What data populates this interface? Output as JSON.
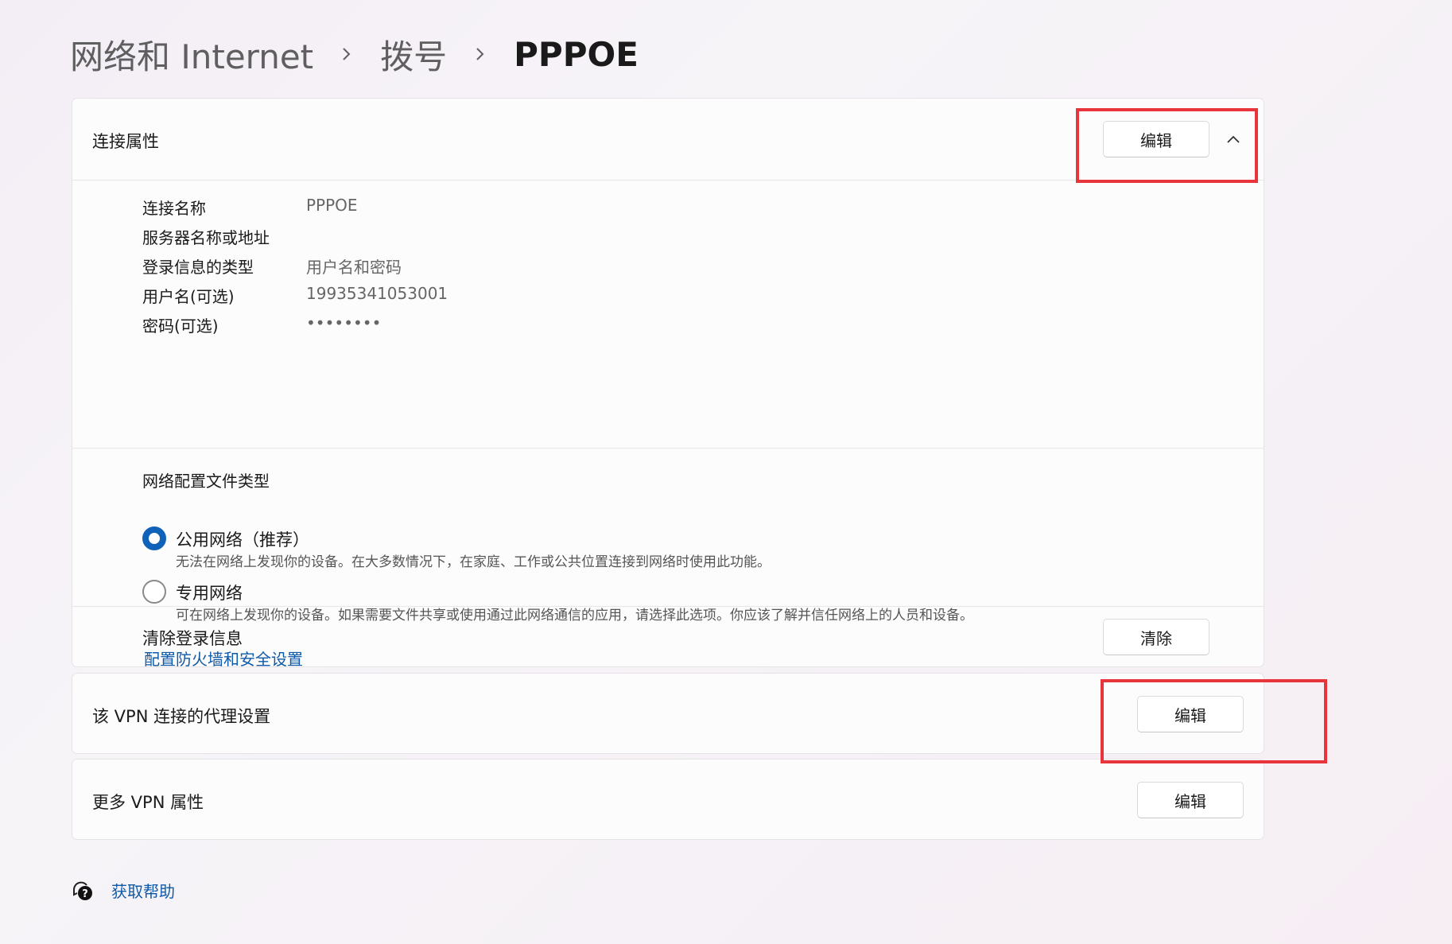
{
  "breadcrumb": {
    "items": [
      "网络和 Internet",
      "拨号"
    ],
    "current": "PPPOE"
  },
  "connection_properties": {
    "title": "连接属性",
    "edit_label": "编辑",
    "expanded": true,
    "fields": [
      {
        "label": "连接名称",
        "value": "PPPOE"
      },
      {
        "label": "服务器名称或地址",
        "value": ""
      },
      {
        "label": "登录信息的类型",
        "value": "用户名和密码"
      },
      {
        "label": "用户名(可选)",
        "value": "19935341053001"
      },
      {
        "label": "密码(可选)",
        "value": "••••••••"
      }
    ]
  },
  "network_profile": {
    "title": "网络配置文件类型",
    "options": [
      {
        "label": "公用网络（推荐）",
        "description": "无法在网络上发现你的设备。在大多数情况下，在家庭、工作或公共位置连接到网络时使用此功能。",
        "selected": true
      },
      {
        "label": "专用网络",
        "description": "可在网络上发现你的设备。如果需要文件共享或使用通过此网络通信的应用，请选择此选项。你应该了解并信任网络上的人员和设备。",
        "selected": false
      }
    ],
    "firewall_link": "配置防火墙和安全设置"
  },
  "clear_login": {
    "label": "清除登录信息",
    "button_label": "清除"
  },
  "proxy": {
    "label": "该 VPN 连接的代理设置",
    "button_label": "编辑"
  },
  "more_vpn": {
    "label": "更多 VPN 属性",
    "button_label": "编辑"
  },
  "help": {
    "label": "获取帮助",
    "icon": "help-chat-icon"
  },
  "colors": {
    "accent": "#0f62b8",
    "highlight": "#e8343b",
    "link": "#0f5aa8"
  }
}
